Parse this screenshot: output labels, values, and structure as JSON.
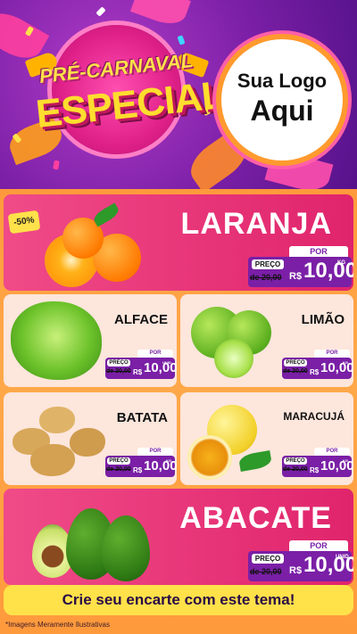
{
  "header": {
    "title_line1": "PRÉ-CARNAVAL",
    "title_line2": "ESPECIAL",
    "logo_line1": "Sua Logo",
    "logo_line2": "Aqui"
  },
  "colors": {
    "purple": "#7a1fa6",
    "pink": "#e0246c",
    "orange": "#ff9a3c",
    "yellow": "#ffe14a"
  },
  "featured": [
    {
      "name": "LARANJA",
      "badge": "-50%",
      "por": "POR",
      "preco": "PREÇO",
      "old": "de 20,00",
      "currency": "R$",
      "value": "10,00",
      "unit": "KG"
    },
    {
      "name": "ABACATE",
      "por": "POR",
      "preco": "PREÇO",
      "old": "de 20,00",
      "currency": "R$",
      "value": "10,00",
      "unit": "UNID"
    }
  ],
  "products": [
    {
      "name": "ALFACE",
      "por": "POR",
      "preco": "PREÇO",
      "old": "de 20,00",
      "currency": "R$",
      "value": "10,00",
      "unit": "UNID"
    },
    {
      "name": "LIMÃO",
      "por": "POR",
      "preco": "PREÇO",
      "old": "de 20,00",
      "currency": "R$",
      "value": "10,00",
      "unit": "KG"
    },
    {
      "name": "BATATA",
      "por": "POR",
      "preco": "PREÇO",
      "old": "de 20,00",
      "currency": "R$",
      "value": "10,00",
      "unit": "KG"
    },
    {
      "name": "MARACUJÁ",
      "por": "POR",
      "preco": "PREÇO",
      "old": "de 20,00",
      "currency": "R$",
      "value": "10,00",
      "unit": "KG"
    }
  ],
  "footer": {
    "cta": "Crie seu encarte com este tema!",
    "disclaimer": "*Imagens Meramente Ilustrativas"
  }
}
